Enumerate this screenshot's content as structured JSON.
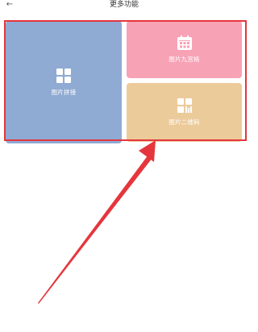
{
  "header": {
    "title": "更多功能",
    "back_icon": "back-arrow-icon"
  },
  "cards": {
    "stitch": {
      "label": "图片拼接",
      "icon": "grid-four-squares-icon",
      "color": "#8faad3"
    },
    "grid": {
      "label": "图片九宫格",
      "icon": "calendar-grid-icon",
      "color": "#f8a2b6"
    },
    "qr": {
      "label": "图片二维码",
      "icon": "qr-code-icon",
      "color": "#eccb9a"
    }
  },
  "annotation": {
    "highlight_color": "#e5363d"
  }
}
